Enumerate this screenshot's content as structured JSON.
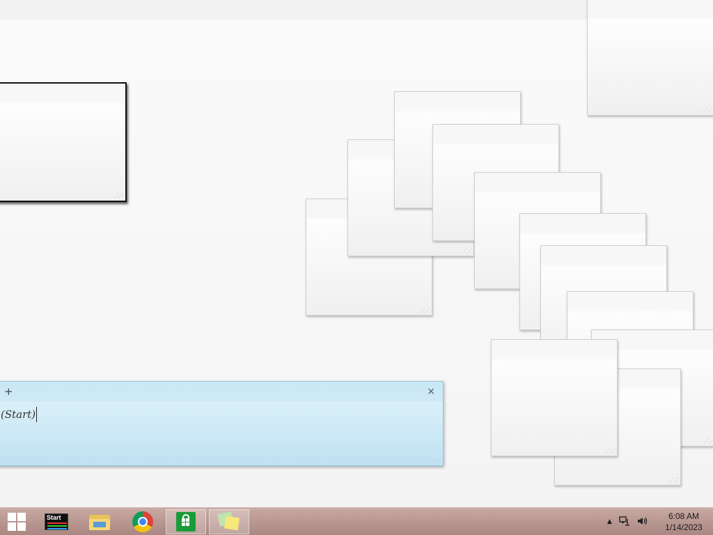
{
  "active_note": {
    "add_label": "+",
    "close_label": "×",
    "text": "(Start)"
  },
  "taskbar": {
    "apps": [
      {
        "name": "start-button",
        "label": ""
      },
      {
        "name": "start-app",
        "icon_label": "Start"
      },
      {
        "name": "file-explorer"
      },
      {
        "name": "chrome"
      },
      {
        "name": "store"
      },
      {
        "name": "sticky-notes"
      }
    ],
    "tray": {
      "show_hidden_label": "▲",
      "clock_time": "6:08 AM",
      "clock_date": "1/14/2023"
    }
  }
}
